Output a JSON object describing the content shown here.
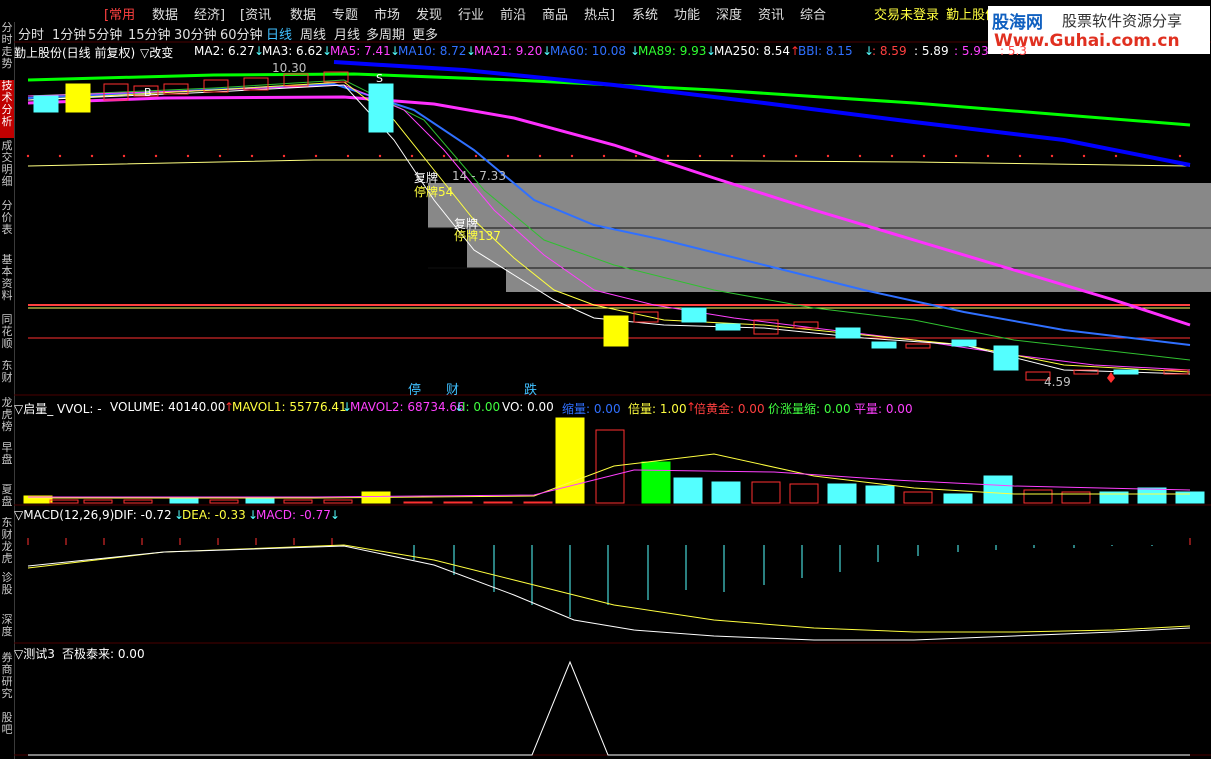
{
  "menu": {
    "items": [
      "[常用",
      "数据",
      "经济]",
      "[资讯",
      "数据",
      "专题",
      "市场",
      "发现",
      "行业",
      "前沿",
      "商品",
      "热点]",
      "系统",
      "功能",
      "深度",
      "资讯",
      "综合"
    ],
    "login": "交易未登录",
    "stock": "勤上股份"
  },
  "logo": {
    "brand": "股海网",
    "slogan": "股票软件资源分享",
    "url": "Www.Guhai.com.cn"
  },
  "timeframes": [
    "分时",
    "1分钟",
    "5分钟",
    "15分钟",
    "30分钟",
    "60分钟",
    "日线",
    "周线",
    "月线",
    "多周期",
    "更多"
  ],
  "sidebar": [
    "分时走势",
    "技术分析",
    "成交明细",
    "分价表",
    "基本资料",
    "同花顺",
    "东财",
    "龙虎榜",
    "早盘",
    "夏盘",
    "东财龙虎",
    "诊股",
    "深度",
    "券商研究",
    "股吧"
  ],
  "main_panel": {
    "title": "勤上股份(日线 前复权)",
    "switch": "▽改变",
    "ma": [
      {
        "label": "MA2: 6.27",
        "arrow": "↓",
        "color": "#ffffff"
      },
      {
        "label": "MA3: 6.62",
        "arrow": "↓",
        "color": "#ffffff"
      },
      {
        "label": "MA5: 7.41",
        "arrow": "↓",
        "color": "#ff40ff"
      },
      {
        "label": "MA10: 8.72",
        "arrow": "↓",
        "color": "#3070ff"
      },
      {
        "label": "MA21: 9.20",
        "arrow": "↓",
        "color": "#ff40ff"
      },
      {
        "label": "MA60: 10.08",
        "arrow": "↓",
        "color": "#3070ff"
      },
      {
        "label": "MA89: 9.93",
        "arrow": "↓",
        "color": "#30ff30"
      },
      {
        "label": "MA250: 8.54",
        "arrow": "↑",
        "color": "#ffffff"
      },
      {
        "label": "BBI: 8.15",
        "arrow": "↓",
        "color": "#3070ff"
      },
      {
        "label": ": 8.59",
        "arrow": "",
        "color": "#ff4040"
      },
      {
        "label": ": 5.89",
        "arrow": "",
        "color": "#ffffff"
      },
      {
        "label": ": 5.93",
        "arrow": "",
        "color": "#ff40ff"
      },
      {
        "label": ": 5.3",
        "arrow": "",
        "color": "#ff4040"
      }
    ],
    "labels": {
      "high": "10.30",
      "low": "4.59",
      "range": "14 - 7.33",
      "resume1": "复牌",
      "suspend1": "停牌54",
      "resume2": "复牌",
      "suspend2": "停牌137",
      "b": "B",
      "s": "S",
      "events": [
        "停",
        "财",
        "跌"
      ]
    }
  },
  "volume_panel": {
    "title": "▽启量_ VVOL: -",
    "fields": [
      {
        "label": "VOLUME: 40140.00",
        "arrow": "↑",
        "color": "#ffffff"
      },
      {
        "label": "MAVOL1: 55776.41",
        "arrow": "↓",
        "color": "#ffff40"
      },
      {
        "label": "MAVOL2: 68734.66",
        "arrow": "↓",
        "color": "#ff40ff"
      },
      {
        "label": "I: 0.00",
        "arrow": "",
        "color": "#40ff40"
      },
      {
        "label": "VO: 0.00",
        "arrow": "",
        "color": "#ffffff"
      },
      {
        "label": "缩量: 0.00",
        "arrow": "",
        "color": "#3070ff"
      },
      {
        "label": "倍量: 1.00",
        "arrow": "↑",
        "color": "#ffff40"
      },
      {
        "label": "倍黄金: 0.00",
        "arrow": "",
        "color": "#ff4040"
      },
      {
        "label": "价涨量缩: 0.00",
        "arrow": "",
        "color": "#40ff40"
      },
      {
        "label": "平量: 0.00",
        "arrow": "",
        "color": "#ff40ff"
      }
    ]
  },
  "macd_panel": {
    "title": "▽MACD(12,26,9)",
    "fields": [
      {
        "label": "DIF: -0.72",
        "arrow": "↓",
        "color": "#ffffff"
      },
      {
        "label": "DEA: -0.33",
        "arrow": "↓",
        "color": "#ffff40"
      },
      {
        "label": "MACD: -0.77",
        "arrow": "↓",
        "color": "#ff40ff"
      }
    ]
  },
  "test_panel": {
    "title": "▽测试3",
    "field": "否极泰来: 0.00"
  },
  "colors": {
    "up": "#ff3030",
    "down": "#54ffff",
    "yellow": "#ffff00",
    "green": "#00ff00"
  }
}
